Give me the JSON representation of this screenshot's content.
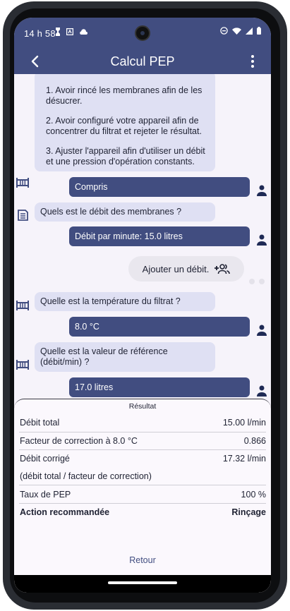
{
  "status": {
    "time": "14 h 58"
  },
  "appbar": {
    "title": "Calcul PEP"
  },
  "chat": {
    "intro_lines": [
      "1. Avoir rincé les membranes afin de les désucrer.",
      "2. Avoir configuré votre appareil afin de concentrer du filtrat et rejeter le résultat.",
      "3. Ajuster l'appareil afin d'utiliser un débit et une pression d'opération constants."
    ],
    "reply_compris": "Compris",
    "q_debit": "Quels est le débit des membranes ?",
    "reply_debit": "Débit par minute: 15.0 litres",
    "add_debit_label": "Ajouter un débit.",
    "q_temperature": "Quelle est la température du filtrat ?",
    "reply_temperature": "8.0 °C",
    "q_reference": "Quelle est la valeur de référence (débit/min) ?",
    "reply_reference": "17.0 litres"
  },
  "result": {
    "title": "Résultat",
    "rows": [
      {
        "label": "Débit total",
        "value": "15.00 l/min"
      },
      {
        "label": "Facteur de correction à 8.0 °C",
        "value": "0.866"
      },
      {
        "label": "Débit corrigé",
        "value": "17.32 l/min"
      },
      {
        "label": "(débit total / facteur de correction)",
        "value": ""
      },
      {
        "label": "Taux de PEP",
        "value": "100 %"
      },
      {
        "label": "Action recommandée",
        "value": "Rinçage"
      }
    ],
    "back_label": "Retour"
  },
  "icons": {
    "back": "arrow-left-icon",
    "menu": "more-vert-icon",
    "bot_filter": "membrane-icon",
    "bot_flow": "flow-icon",
    "user": "person-icon",
    "add_person": "group-add-icon"
  },
  "colors": {
    "primary": "#414d80",
    "bot_bubble": "#dfe0f3",
    "background": "#f6f3fa"
  }
}
